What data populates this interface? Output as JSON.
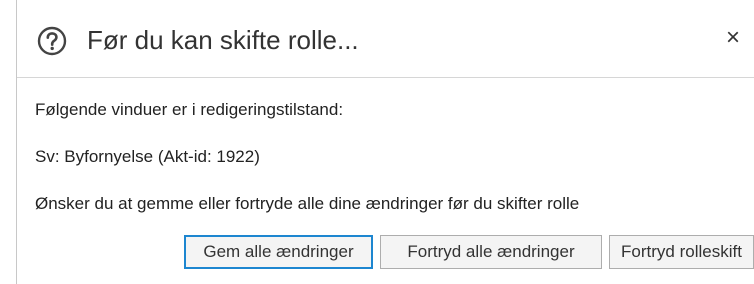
{
  "dialog": {
    "title": "Før du kan skifte rolle...",
    "close_glyph": "×",
    "help_icon": "question-circle-icon",
    "close_icon": "close-icon"
  },
  "body": {
    "line1": "Følgende vinduer er i redigeringstilstand:",
    "line2": "Sv: Byfornyelse (Akt-id: 1922)",
    "line3": "Ønsker du at gemme eller fortryde alle dine ændringer før du skifter rolle"
  },
  "buttons": {
    "save_all": "Gem alle ændringer",
    "undo_all": "Fortryd alle ændringer",
    "undo_role": "Fortryd rolleskift"
  },
  "colors": {
    "primary_border": "#1d86d0",
    "button_bg": "#f4f4f4",
    "icon_color": "#444444"
  }
}
